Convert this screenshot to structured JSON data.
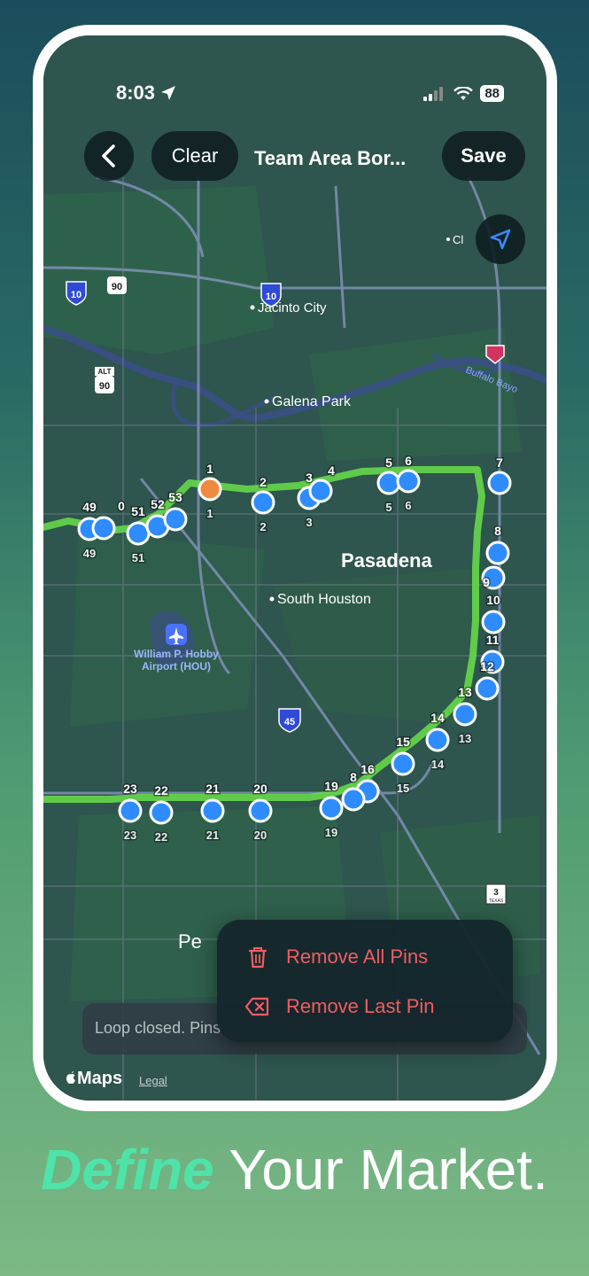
{
  "status": {
    "time": "8:03",
    "battery": "88"
  },
  "nav": {
    "clear_label": "Clear",
    "title": "Team Area Bor...",
    "save_label": "Save"
  },
  "map_labels": {
    "jacinto_city": "Jacinto City",
    "galena_park": "Galena Park",
    "pasadena": "Pasadena",
    "south_houston": "South Houston",
    "airport_line1": "William P. Hobby",
    "airport_line2": "Airport (HOU)",
    "buffalo_bayou": "Buffalo Bayo",
    "cl": "Cl",
    "pe": "Pe",
    "texas": "TEXAS"
  },
  "shields": {
    "i10_west": "10",
    "us90_top": "90",
    "i10_east": "10",
    "alt_label": "ALT",
    "us90_alt": "90",
    "i45": "45",
    "sh3": "3"
  },
  "pins": [
    {
      "label": "1",
      "sub": "1",
      "color": "orange"
    },
    {
      "label": "2",
      "sub": "2"
    },
    {
      "label": "3",
      "sub": "3"
    },
    {
      "label": "4",
      "sub": ""
    },
    {
      "label": "5",
      "sub": "5"
    },
    {
      "label": "6",
      "sub": "6"
    },
    {
      "label": "7",
      "sub": ""
    },
    {
      "label": "8",
      "sub": ""
    },
    {
      "label": "9",
      "sub": ""
    },
    {
      "label": "10",
      "sub": ""
    },
    {
      "label": "11",
      "sub": ""
    },
    {
      "label": "12",
      "sub": ""
    },
    {
      "label": "13",
      "sub": "13"
    },
    {
      "label": "14",
      "sub": "14"
    },
    {
      "label": "15",
      "sub": "15"
    },
    {
      "label": "16",
      "sub": ""
    },
    {
      "label": "8",
      "sub": ""
    },
    {
      "label": "19",
      "sub": "19"
    },
    {
      "label": "20",
      "sub": "20"
    },
    {
      "label": "21",
      "sub": "21"
    },
    {
      "label": "22",
      "sub": "22"
    },
    {
      "label": "23",
      "sub": "23"
    },
    {
      "label": "49",
      "sub": "49"
    },
    {
      "label": "0",
      "sub": ""
    },
    {
      "label": "51",
      "sub": "51"
    },
    {
      "label": "52",
      "sub": ""
    },
    {
      "label": "53",
      "sub": ""
    }
  ],
  "toast": "Loop closed. Pins",
  "menu": {
    "remove_all": "Remove All Pins",
    "remove_last": "Remove Last Pin"
  },
  "footer": {
    "maps": "Maps",
    "legal": "Legal"
  },
  "tagline": {
    "emphasis": "Define",
    "rest": "Your Market."
  },
  "colors": {
    "pin_blue": "#2f8cff",
    "pin_orange": "#f08a3c",
    "route_green": "#66d84a",
    "destructive": "#ef5d63",
    "accent": "#4ee3a9"
  }
}
